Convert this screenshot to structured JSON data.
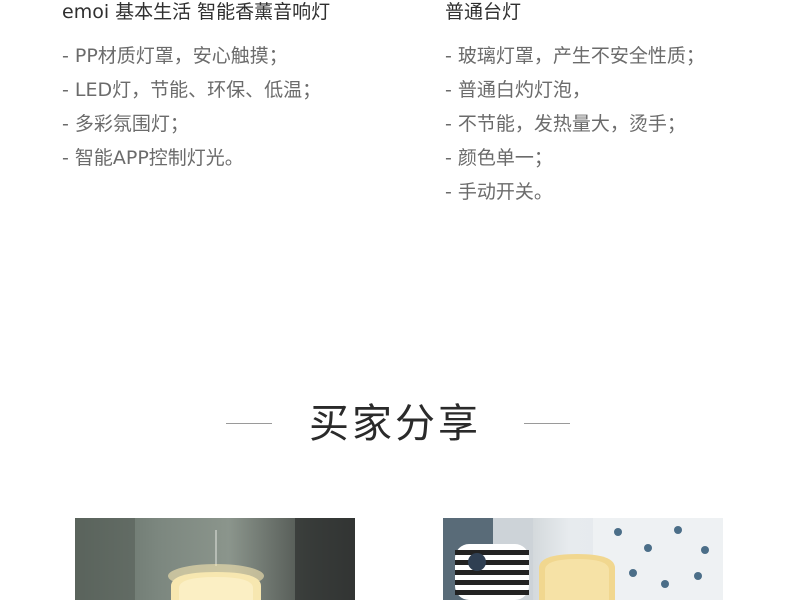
{
  "left_column": {
    "title": "emoi 基本生活 智能香薰音响灯",
    "items": [
      "- PP材质灯罩，安心触摸；",
      "- LED灯，节能、环保、低温；",
      "- 多彩氛围灯；",
      "- 智能APP控制灯光。"
    ]
  },
  "right_column": {
    "title": "普通台灯",
    "items": [
      "- 玻璃灯罩，产生不安全性质；",
      "- 普通白灼灯泡，",
      "- 不节能，发热量大，烫手；",
      "- 颜色单一；",
      "- 手动开关。"
    ]
  },
  "section": {
    "title": "买家分享"
  },
  "photos": [
    {
      "name": "buyer-photo-1"
    },
    {
      "name": "buyer-photo-2"
    }
  ]
}
